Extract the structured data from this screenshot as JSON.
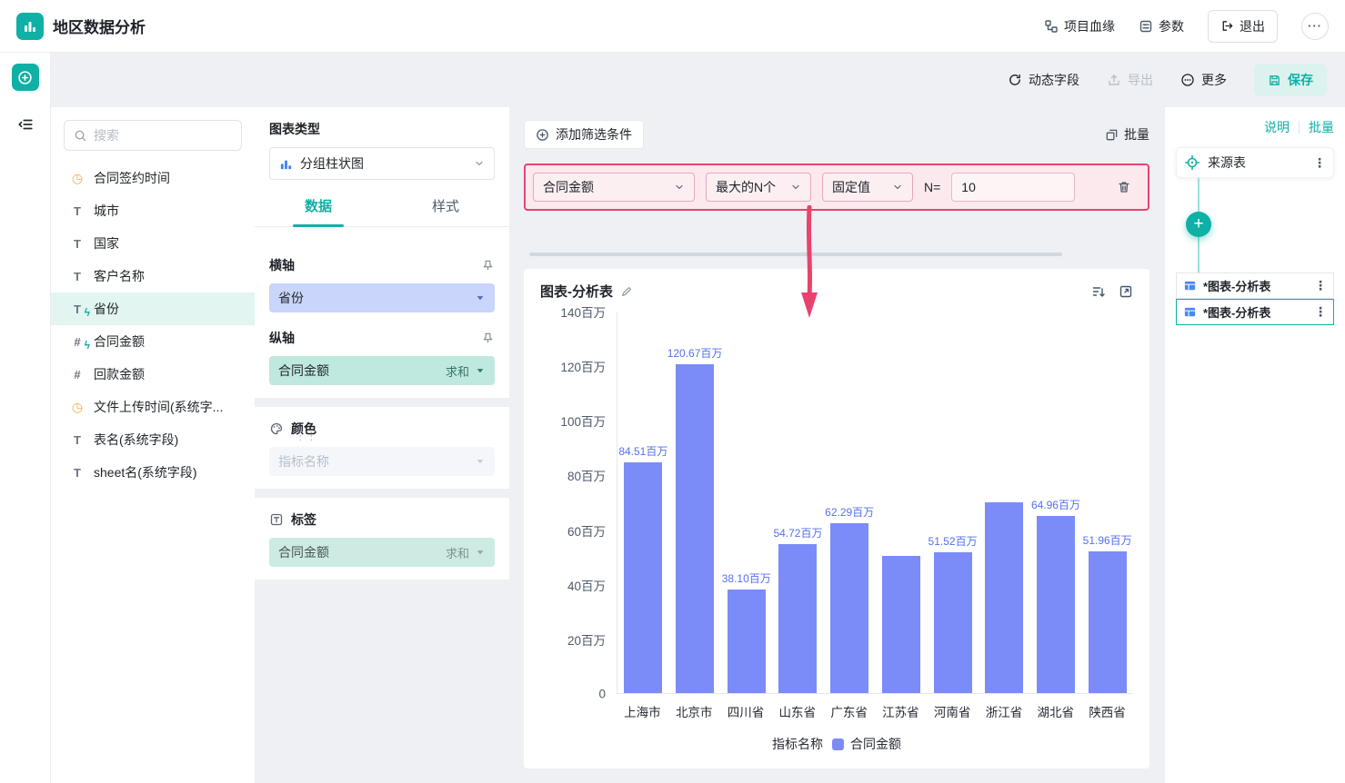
{
  "header": {
    "title": "地区数据分析",
    "actions": {
      "lineage": "项目血缘",
      "params": "参数",
      "exit": "退出",
      "more": "⋯"
    }
  },
  "toolbar": {
    "dynamic_fields": "动态字段",
    "export": "导出",
    "more": "更多",
    "save": "保存"
  },
  "fields_panel": {
    "search_placeholder": "搜索",
    "fields": [
      {
        "label": "合同签约时间",
        "type": "time"
      },
      {
        "label": "城市",
        "type": "text"
      },
      {
        "label": "国家",
        "type": "text"
      },
      {
        "label": "客户名称",
        "type": "text"
      },
      {
        "label": "省份",
        "type": "text",
        "selected": true,
        "in_use": true
      },
      {
        "label": "合同金额",
        "type": "number",
        "in_use": true
      },
      {
        "label": "回款金额",
        "type": "number"
      },
      {
        "label": "文件上传时间(系统字...",
        "type": "time"
      },
      {
        "label": "表名(系统字段)",
        "type": "text"
      },
      {
        "label": "sheet名(系统字段)",
        "type": "text"
      }
    ]
  },
  "config_panel": {
    "chart_type_label": "图表类型",
    "chart_type_value": "分组柱状图",
    "tabs": [
      {
        "label": "数据"
      },
      {
        "label": "样式"
      }
    ],
    "x_axis": {
      "label": "横轴",
      "field": "省份"
    },
    "y_axis": {
      "label": "纵轴",
      "field": "合同金额",
      "agg": "求和"
    },
    "color": {
      "label": "颜色",
      "placeholder": "指标名称"
    },
    "tag": {
      "label": "标签",
      "field": "合同金额",
      "agg": "求和"
    }
  },
  "canvas": {
    "add_filter": "添加筛选条件",
    "batch": "批量",
    "filter": {
      "field": "合同金额",
      "mode": "最大的N个",
      "value_type": "固定值",
      "n_label": "N=",
      "n_value": "10"
    },
    "chart_card": {
      "title": "图表-分析表"
    }
  },
  "right_panel": {
    "links": [
      "说明",
      "批量"
    ],
    "source_node": "来源表",
    "nodes": [
      "*图表-分析表",
      "*图表-分析表"
    ]
  },
  "chart_data": {
    "type": "bar",
    "title": "图表-分析表",
    "categories": [
      "上海市",
      "北京市",
      "四川省",
      "山东省",
      "广东省",
      "江苏省",
      "河南省",
      "浙江省",
      "湖北省",
      "陕西省"
    ],
    "series": [
      {
        "name": "合同金额",
        "values": [
          84.51,
          120.67,
          38.1,
          54.72,
          62.29,
          50.5,
          51.52,
          69.9,
          64.96,
          51.96
        ]
      }
    ],
    "data_labels": [
      "84.51百万",
      "120.67百万",
      "38.10百万",
      "54.72百万",
      "62.29百万",
      "",
      "51.52百万",
      "",
      "64.96百万",
      "51.96百万"
    ],
    "yticks": [
      "140百万",
      "120百万",
      "100百万",
      "80百万",
      "60百万",
      "40百万",
      "20百万",
      "0"
    ],
    "ytick_values": [
      140,
      120,
      100,
      80,
      60,
      40,
      20,
      0
    ],
    "y_unit": "百万",
    "ylim": [
      0,
      140
    ],
    "grid": false,
    "legend_position": "bottom",
    "legend_title": "指标名称",
    "legend_items": [
      "合同金额"
    ],
    "bar_color": "#7b8cf8"
  },
  "colors": {
    "accent": "#0fb0a5",
    "bar": "#7b8cf8",
    "annotation": "#e8436e",
    "data_label": "#5570ef",
    "node_icon_blue": "#4c86f8"
  }
}
